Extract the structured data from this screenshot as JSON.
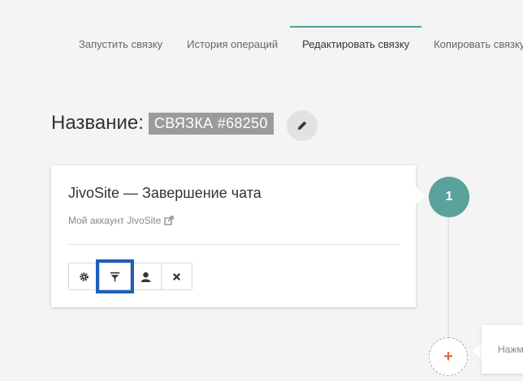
{
  "tabs": [
    {
      "label": "Запустить связку"
    },
    {
      "label": "История операций"
    },
    {
      "label": "Редактировать связку",
      "active": true
    },
    {
      "label": "Копировать связку"
    }
  ],
  "title": {
    "label": "Название:",
    "value": "СВЯЗКА #68250"
  },
  "card": {
    "title": "JivoSite — Завершение чата",
    "account": "Мой аккаунт JivoSite",
    "tools": [
      "gear-icon",
      "filter-icon",
      "user-icon",
      "close-icon"
    ],
    "selected_tool": "filter-icon"
  },
  "step": {
    "number": "1"
  },
  "add": {
    "symbol": "+"
  },
  "hint": {
    "text": "Нажм"
  },
  "colors": {
    "accent": "#5aa39c",
    "highlight": "#1f5fb8",
    "add": "#e46a3a"
  }
}
